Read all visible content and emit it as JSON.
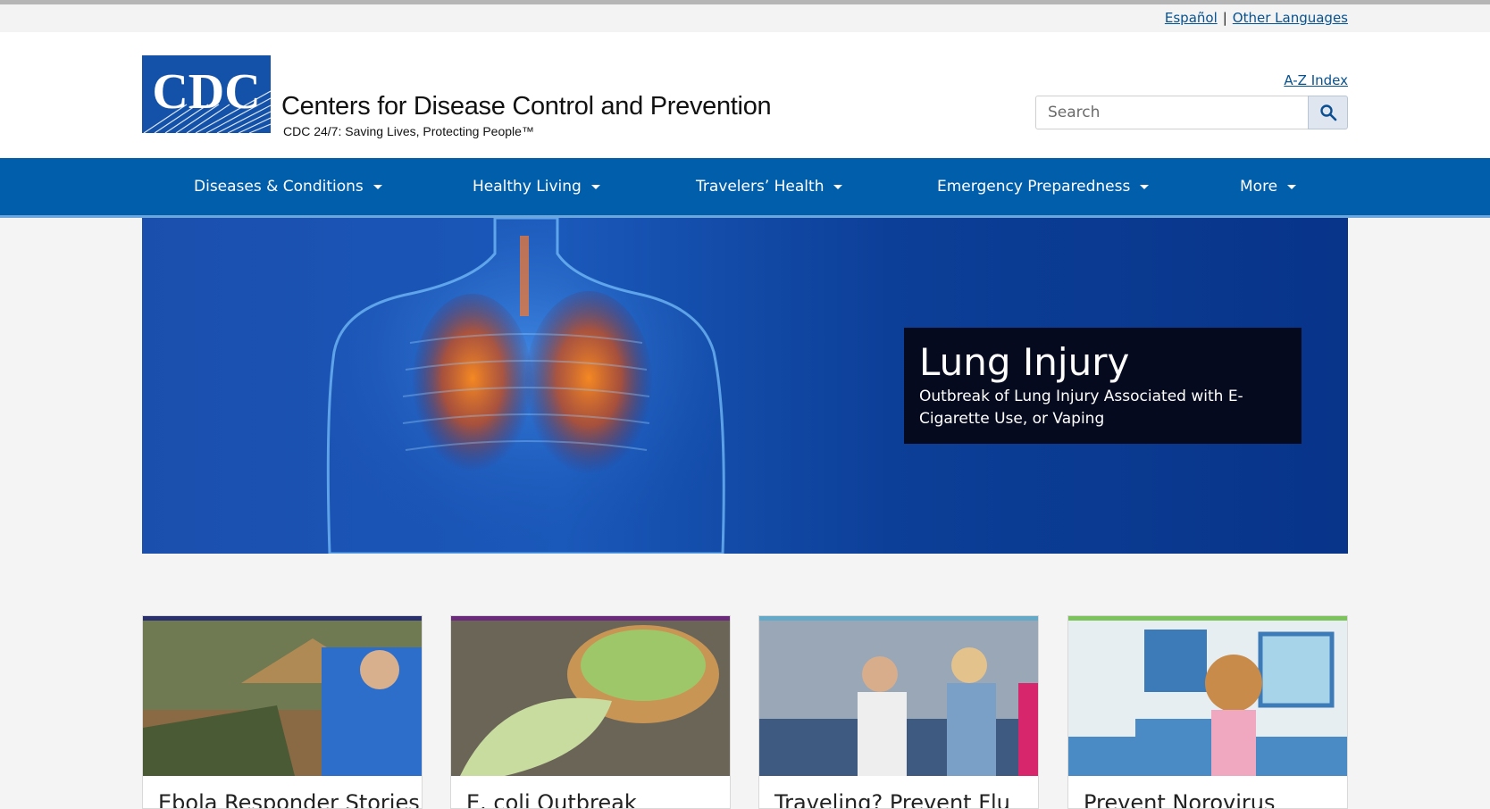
{
  "language_bar": {
    "espanol": "Español",
    "separator": "|",
    "other_languages": "Other Languages"
  },
  "header": {
    "logo_letters": "CDC",
    "agency_name": "Centers for Disease Control and Prevention",
    "tagline": "CDC 24/7: Saving Lives, Protecting People™",
    "az_index": "A-Z Index",
    "search_placeholder": "Search",
    "search_icon": "search-icon"
  },
  "nav": {
    "items": [
      {
        "label": "Diseases & Conditions"
      },
      {
        "label": "Healthy Living"
      },
      {
        "label": "Travelers’ Health"
      },
      {
        "label": "Emergency Preparedness"
      },
      {
        "label": "More"
      }
    ]
  },
  "hero": {
    "title": "Lung Injury",
    "subtitle": "Outbreak of Lung Injury Associated with E-Cigarette Use, or Vaping"
  },
  "cards": [
    {
      "title": "Ebola Responder Stories",
      "accent": "#2a2f6e"
    },
    {
      "title": "E. coli Outbreak",
      "accent": "#6b2a7c"
    },
    {
      "title": "Traveling? Prevent Flu",
      "accent": "#64aac8"
    },
    {
      "title": "Prevent Norovirus",
      "accent": "#7dc35b"
    }
  ],
  "colors": {
    "nav_bg": "#005eaa",
    "link": "#075290",
    "hero_card_bg": "#050a1f"
  }
}
